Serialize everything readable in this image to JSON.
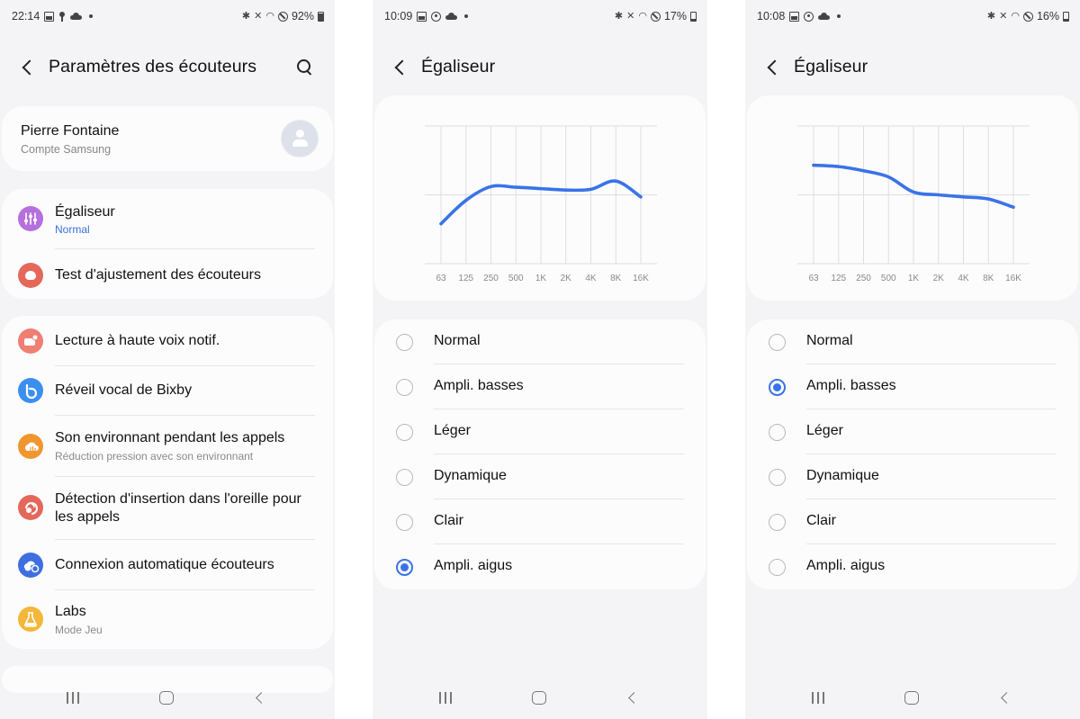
{
  "colors": {
    "accent": "#3a73e8",
    "curve": "#3a73e8",
    "subtitle_blue": "#3a73d9",
    "background": "#f4f4f6",
    "card": "#fcfcfc",
    "grid": "#dedede"
  },
  "screens": [
    {
      "status": {
        "time": "22:14",
        "battery": "92%"
      },
      "header": {
        "title": "Paramètres des écouteurs"
      },
      "account": {
        "name": "Pierre Fontaine",
        "subtitle": "Compte Samsung"
      },
      "menu_groups": [
        [
          {
            "icon": "equalizer-icon",
            "color": "#b66fde",
            "label": "Égaliseur",
            "sub": "Normal"
          },
          {
            "icon": "earbud-fit-icon",
            "color": "#e4685a",
            "label": "Test d'ajustement des écouteurs"
          }
        ],
        [
          {
            "icon": "read-notifications-icon",
            "color": "#f07f73",
            "label": "Lecture à haute voix notif."
          },
          {
            "icon": "bixby-icon",
            "color": "#3b8ff0",
            "label": "Réveil vocal de Bixby"
          },
          {
            "icon": "ambient-sound-icon",
            "color": "#f0962e",
            "label": "Son environnant pendant les appels",
            "sub": "Réduction pression avec son environnant"
          },
          {
            "icon": "in-ear-detection-icon",
            "color": "#e4685a",
            "label": "Détection d'insertion dans l'oreille pour les appels"
          },
          {
            "icon": "auto-connect-icon",
            "color": "#3d6fe0",
            "label": "Connexion automatique écouteurs"
          },
          {
            "icon": "labs-icon",
            "color": "#f4b73a",
            "label": "Labs",
            "sub": "Mode Jeu"
          }
        ]
      ]
    },
    {
      "status": {
        "time": "10:09",
        "battery": "17%"
      },
      "header": {
        "title": "Égaliseur"
      },
      "radio_options": [
        "Normal",
        "Ampli. basses",
        "Léger",
        "Dynamique",
        "Clair",
        "Ampli. aigus"
      ],
      "selected_index": 5
    },
    {
      "status": {
        "time": "10:08",
        "battery": "16%"
      },
      "header": {
        "title": "Égaliseur"
      },
      "radio_options": [
        "Normal",
        "Ampli. basses",
        "Léger",
        "Dynamique",
        "Clair",
        "Ampli. aigus"
      ],
      "selected_index": 1
    }
  ],
  "chart_data": [
    {
      "type": "line",
      "title": "Égaliseur — Ampli. aigus",
      "categories": [
        "63",
        "125",
        "250",
        "500",
        "1K",
        "2K",
        "4K",
        "8K",
        "16K"
      ],
      "series": [
        {
          "name": "Ampli. aigus",
          "values": [
            -4.2,
            -0.8,
            1.2,
            1.1,
            0.9,
            0.7,
            0.8,
            2.0,
            -0.3
          ]
        }
      ],
      "ylim": [
        -10,
        10
      ],
      "grid": true,
      "xlabel": "",
      "ylabel": ""
    },
    {
      "type": "line",
      "title": "Égaliseur — Ampli. basses",
      "categories": [
        "63",
        "125",
        "250",
        "500",
        "1K",
        "2K",
        "4K",
        "8K",
        "16K"
      ],
      "series": [
        {
          "name": "Ampli. basses",
          "values": [
            4.3,
            4.1,
            3.5,
            2.6,
            0.4,
            0.0,
            -0.3,
            -0.6,
            -1.8
          ]
        }
      ],
      "ylim": [
        -10,
        10
      ],
      "grid": true,
      "xlabel": "",
      "ylabel": ""
    }
  ]
}
